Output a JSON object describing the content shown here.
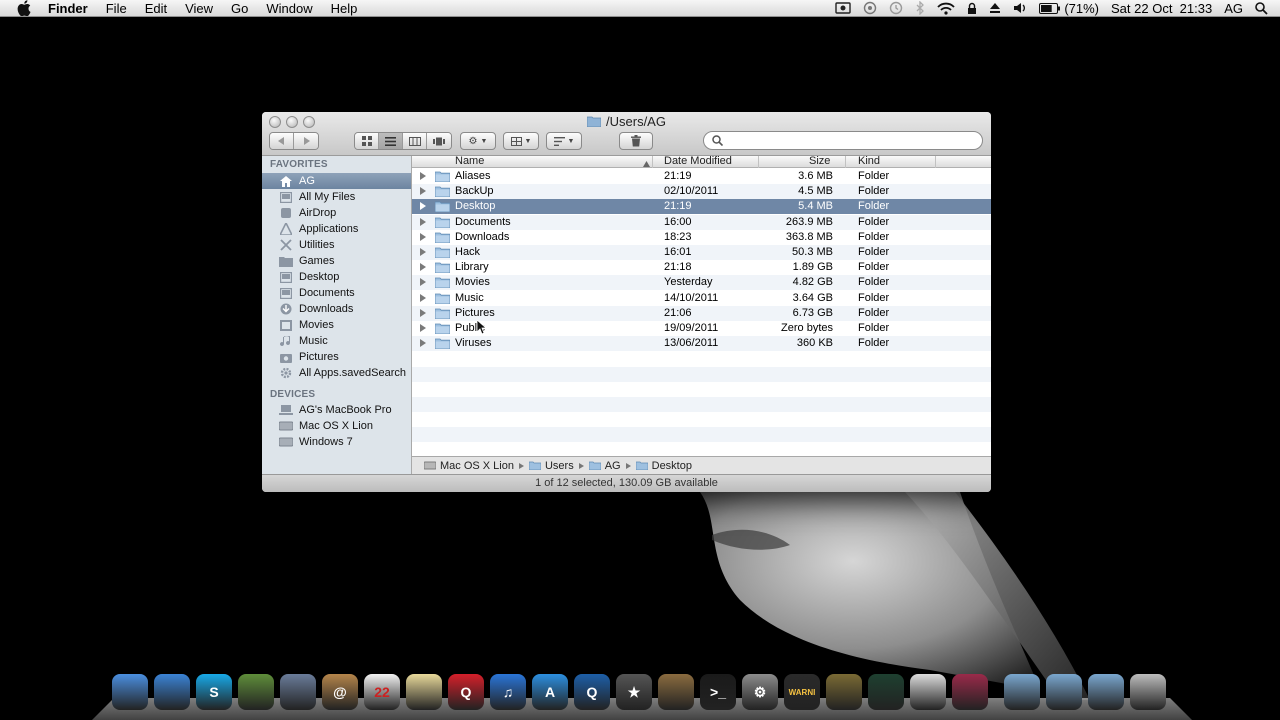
{
  "menubar": {
    "app_name": "Finder",
    "items": [
      "File",
      "Edit",
      "View",
      "Go",
      "Window",
      "Help"
    ],
    "battery_text": "(71%)",
    "clock": "Sat 22 Oct  21:33",
    "user": "AG"
  },
  "window": {
    "title": "/Users/AG",
    "search_placeholder": ""
  },
  "sidebar": {
    "favorites_header": "FAVORITES",
    "favorites": [
      {
        "label": "AG",
        "icon": "home-icon"
      },
      {
        "label": "All My Files",
        "icon": "all-files-icon"
      },
      {
        "label": "AirDrop",
        "icon": "airdrop-icon"
      },
      {
        "label": "Applications",
        "icon": "applications-icon"
      },
      {
        "label": "Utilities",
        "icon": "utilities-icon"
      },
      {
        "label": "Games",
        "icon": "folder-icon"
      },
      {
        "label": "Desktop",
        "icon": "desktop-icon"
      },
      {
        "label": "Documents",
        "icon": "documents-icon"
      },
      {
        "label": "Downloads",
        "icon": "downloads-icon"
      },
      {
        "label": "Movies",
        "icon": "movies-icon"
      },
      {
        "label": "Music",
        "icon": "music-icon"
      },
      {
        "label": "Pictures",
        "icon": "pictures-icon"
      },
      {
        "label": "All Apps.savedSearch",
        "icon": "gear-icon"
      }
    ],
    "devices_header": "DEVICES",
    "devices": [
      {
        "label": "AG's MacBook Pro",
        "icon": "laptop-icon"
      },
      {
        "label": "Mac OS X Lion",
        "icon": "disk-icon"
      },
      {
        "label": "Windows 7",
        "icon": "disk-icon"
      }
    ]
  },
  "columns": {
    "name": "Name",
    "date": "Date Modified",
    "size": "Size",
    "kind": "Kind"
  },
  "files": [
    {
      "name": "Aliases",
      "date": "21:19",
      "size": "3.6 MB",
      "kind": "Folder"
    },
    {
      "name": "BackUp",
      "date": "02/10/2011",
      "size": "4.5 MB",
      "kind": "Folder"
    },
    {
      "name": "Desktop",
      "date": "21:19",
      "size": "5.4 MB",
      "kind": "Folder"
    },
    {
      "name": "Documents",
      "date": "16:00",
      "size": "263.9 MB",
      "kind": "Folder"
    },
    {
      "name": "Downloads",
      "date": "18:23",
      "size": "363.8 MB",
      "kind": "Folder"
    },
    {
      "name": "Hack",
      "date": "16:01",
      "size": "50.3 MB",
      "kind": "Folder"
    },
    {
      "name": "Library",
      "date": "21:18",
      "size": "1.89 GB",
      "kind": "Folder"
    },
    {
      "name": "Movies",
      "date": "Yesterday",
      "size": "4.82 GB",
      "kind": "Folder"
    },
    {
      "name": "Music",
      "date": "14/10/2011",
      "size": "3.64 GB",
      "kind": "Folder"
    },
    {
      "name": "Pictures",
      "date": "21:06",
      "size": "6.73 GB",
      "kind": "Folder"
    },
    {
      "name": "Public",
      "date": "19/09/2011",
      "size": "Zero bytes",
      "kind": "Folder"
    },
    {
      "name": "Viruses",
      "date": "13/06/2011",
      "size": "360 KB",
      "kind": "Folder"
    }
  ],
  "path": [
    "Mac OS X Lion",
    "Users",
    "AG",
    "Desktop"
  ],
  "status": "1 of 12 selected, 130.09 GB available",
  "dock": {
    "icons": [
      {
        "name": "finder-icon",
        "color": "#4b8fe0",
        "glyph": ""
      },
      {
        "name": "safari-icon",
        "color": "#3b83d6",
        "glyph": ""
      },
      {
        "name": "skype-icon",
        "color": "#18a9e8",
        "glyph": "S"
      },
      {
        "name": "dashboard-icon",
        "color": "#5f8d3a",
        "glyph": ""
      },
      {
        "name": "preview-icon",
        "color": "#6a7c9a",
        "glyph": ""
      },
      {
        "name": "address-book-icon",
        "color": "#b5854b",
        "glyph": "@"
      },
      {
        "name": "ical-icon",
        "color": "#f2f2f2",
        "glyph": "22"
      },
      {
        "name": "notes-icon",
        "color": "#e8d99a",
        "glyph": ""
      },
      {
        "name": "quick-icon",
        "color": "#d51f2a",
        "glyph": "Q"
      },
      {
        "name": "itunes-icon",
        "color": "#2a75d8",
        "glyph": "♫"
      },
      {
        "name": "app-store-icon",
        "color": "#2c8fe0",
        "glyph": "A"
      },
      {
        "name": "quicktime-icon",
        "color": "#1d5fa8",
        "glyph": "Q"
      },
      {
        "name": "imovie-icon",
        "color": "#555555",
        "glyph": "★"
      },
      {
        "name": "iphoto-icon",
        "color": "#8a6b3f",
        "glyph": ""
      },
      {
        "name": "terminal-icon",
        "color": "#1a1a1a",
        "glyph": ">_"
      },
      {
        "name": "system-preferences-icon",
        "color": "#8c8c8c",
        "glyph": "⚙"
      },
      {
        "name": "console-icon",
        "color": "#2a2a2a",
        "glyph": "WARNI"
      },
      {
        "name": "time-machine-icon",
        "color": "#7a6a34",
        "glyph": ""
      },
      {
        "name": "activity-monitor-icon",
        "color": "#1e4030",
        "glyph": ""
      },
      {
        "name": "textedit-icon",
        "color": "#dcdcdc",
        "glyph": ""
      },
      {
        "name": "photo-booth-icon",
        "color": "#9a2a4a",
        "glyph": ""
      },
      {
        "name": "applications-stack-icon",
        "color": "#7aa7cf",
        "glyph": ""
      },
      {
        "name": "documents-stack-icon",
        "color": "#7aa7cf",
        "glyph": ""
      },
      {
        "name": "downloads-stack-icon",
        "color": "#7aa7cf",
        "glyph": ""
      },
      {
        "name": "trash-icon",
        "color": "#bdbdbd",
        "glyph": ""
      }
    ]
  }
}
